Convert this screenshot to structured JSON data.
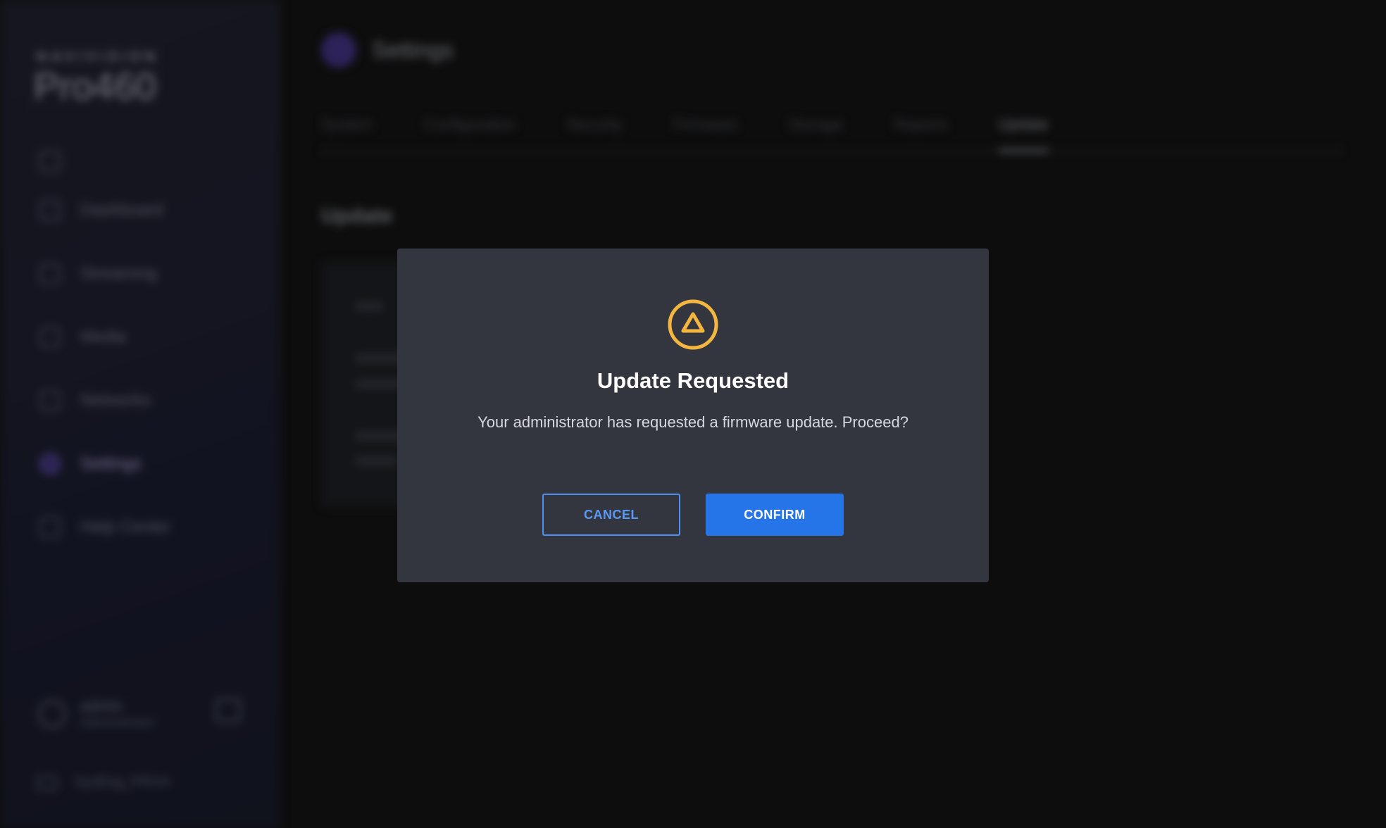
{
  "app": {
    "brand_small": "NAVIVISION",
    "brand_large": "Pro460"
  },
  "sidebar": {
    "items": [
      {
        "label": ""
      },
      {
        "label": "Dashboard"
      },
      {
        "label": "Streaming"
      },
      {
        "label": "Media"
      },
      {
        "label": "Networks"
      },
      {
        "label": "Settings"
      },
      {
        "label": "Help Center"
      }
    ],
    "user": {
      "name": "admin",
      "role": "Administrator"
    },
    "device": "SysEng_PRO4"
  },
  "main": {
    "page_title": "Settings",
    "tabs": [
      {
        "label": "System"
      },
      {
        "label": "Configuration"
      },
      {
        "label": "Security"
      },
      {
        "label": "Firmware"
      },
      {
        "label": "Storage"
      },
      {
        "label": "Reports"
      },
      {
        "label": "Update"
      }
    ],
    "section_title": "Update"
  },
  "modal": {
    "title": "Update Requested",
    "message": "Your administrator has requested a firmware update. Proceed?",
    "cancel_label": "CANCEL",
    "confirm_label": "CONFIRM",
    "icon": "warning-triangle-icon",
    "icon_color": "#f4b63f",
    "confirm_color": "#2574e8"
  }
}
